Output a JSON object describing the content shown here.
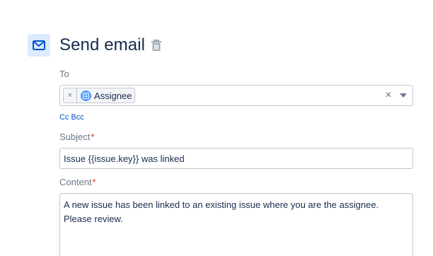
{
  "action": {
    "icon": "mail-icon",
    "title": "Send email",
    "delete_icon": "trash-icon"
  },
  "to": {
    "label": "To",
    "chips": [
      {
        "remove_icon": "×",
        "avatar_icon": "user-field-icon",
        "label": "Assignee"
      }
    ],
    "clear_icon": "×",
    "dropdown_icon": "chevron-down-icon"
  },
  "cc_bcc": {
    "cc": "Cc",
    "bcc": "Bcc"
  },
  "subject": {
    "label": "Subject",
    "required_mark": "*",
    "value": "Issue {{issue.key}} was linked"
  },
  "content": {
    "label": "Content",
    "required_mark": "*",
    "value": "A new issue has been linked to an existing issue where you are the assignee.\nPlease review."
  },
  "colors": {
    "accent": "#0052cc",
    "icon_bg": "#deebff",
    "required": "#de350b",
    "border": "#c1c7d0"
  }
}
